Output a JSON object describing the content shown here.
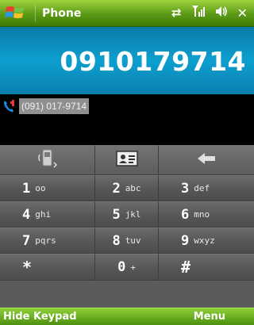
{
  "titlebar": {
    "title": "Phone",
    "status_icons": [
      "sync-icon",
      "signal-icon",
      "volume-icon",
      "close-icon"
    ]
  },
  "display": {
    "dialed_number": "0910179714"
  },
  "suggestion": {
    "text": "(091) 017-9714"
  },
  "keypad": {
    "top_row": [
      "speaker-phone-icon",
      "contact-card-icon",
      "backspace-icon"
    ],
    "keys": [
      {
        "digit": "1",
        "letters": "oo"
      },
      {
        "digit": "2",
        "letters": "abc"
      },
      {
        "digit": "3",
        "letters": "def"
      },
      {
        "digit": "4",
        "letters": "ghi"
      },
      {
        "digit": "5",
        "letters": "jkl"
      },
      {
        "digit": "6",
        "letters": "mno"
      },
      {
        "digit": "7",
        "letters": "pqrs"
      },
      {
        "digit": "8",
        "letters": "tuv"
      },
      {
        "digit": "9",
        "letters": "wxyz"
      },
      {
        "digit": "*",
        "letters": ""
      },
      {
        "digit": "0",
        "letters": "+"
      },
      {
        "digit": "#",
        "letters": ""
      }
    ]
  },
  "softkeys": {
    "left": "Hide Keypad",
    "right": "Menu"
  },
  "colors": {
    "titlebar_green": "#5b9a16",
    "display_blue": "#0d9fcf",
    "keypad_gray": "#5b5b5b"
  }
}
